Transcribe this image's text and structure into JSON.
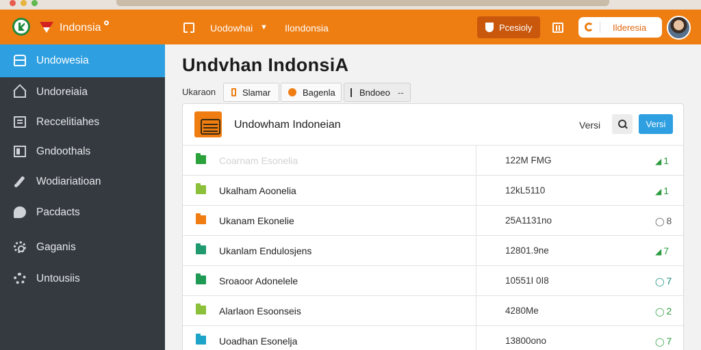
{
  "colors": {
    "header": "#ee7d12",
    "sidebar": "#353a41",
    "accent": "#2e9fe0",
    "count_green": "#2a9a3c",
    "count_teal": "#138a7a",
    "count_gray": "#555555"
  },
  "header": {
    "app_title": "Indonsia",
    "menu_label": "Uodowhai",
    "link_label": "Ilondonsia",
    "action_label": "Pcesioly",
    "search_value": "Ilderesia",
    "icons": {
      "logo": "logo-icon",
      "flag": "flag-icon",
      "book": "book-icon",
      "chevron": "chevron-down-icon",
      "shield": "shield-icon",
      "columns": "columns-icon",
      "search": "refresh-icon",
      "avatar": "avatar"
    }
  },
  "sidebar": {
    "items": [
      {
        "label": "Undowesia",
        "icon": "database-icon",
        "active": true
      },
      {
        "label": "Undoreiaia",
        "icon": "home-icon",
        "active": false
      },
      {
        "label": "Reccelitiahes",
        "icon": "document-icon",
        "active": false
      },
      {
        "label": "Gndoothals",
        "icon": "window-icon",
        "active": false
      },
      {
        "label": "Wodiariatioan",
        "icon": "pen-icon",
        "active": false
      },
      {
        "label": "Pacdacts",
        "icon": "chat-bubble-icon",
        "active": false
      },
      {
        "label": "Gaganis",
        "icon": "gear-icon",
        "active": false
      },
      {
        "label": "Untousiis",
        "icon": "settings-icon",
        "active": false
      }
    ]
  },
  "main": {
    "title": "Undvhan IndonsiA",
    "breadcrumb": "Ukaraon",
    "tabs": [
      {
        "label": "Slamar",
        "icon": "bookmark-icon"
      },
      {
        "label": "Bagenla",
        "icon": "shield-icon"
      },
      {
        "label": "Bndoeo",
        "icon": "tag-icon",
        "extra": "--"
      }
    ],
    "panel": {
      "title": "Undowham Indoneian",
      "version_label": "Versi",
      "button_label": "Versi",
      "rows": [
        {
          "name": "Coarnam Esonelia",
          "size": "122M FMG",
          "count": "1",
          "folder_color": "#2aa13a",
          "count_color": "#2a9a3c",
          "faded": true
        },
        {
          "name": "Ukalham Aoonelia",
          "size": "12kL5110",
          "count": "1",
          "folder_color": "#8cc03a",
          "count_color": "#2a9a3c",
          "faded": false
        },
        {
          "name": "Ukanam Ekonelie",
          "size": "25A1131no",
          "count": "8",
          "folder_color": "#ef7d12",
          "count_color": "#555555",
          "faded": false
        },
        {
          "name": "Ukanlam Endulosjens",
          "size": "12801.9ne",
          "count": "7",
          "folder_color": "#1f9a6e",
          "count_color": "#2a9a3c",
          "faded": false
        },
        {
          "name": "Sroaoor Adonelele",
          "size": "10551I 0I8",
          "count": "7",
          "folder_color": "#1f9a55",
          "count_color": "#138a7a",
          "faded": false
        },
        {
          "name": "Alarlaon Esoonseis",
          "size": "4280Me",
          "count": "2",
          "folder_color": "#8cc03a",
          "count_color": "#2a9a3c",
          "faded": false
        },
        {
          "name": "Uoadhan Esonelja",
          "size": "13800ono",
          "count": "7",
          "folder_color": "#1ea4c8",
          "count_color": "#2a9a3c",
          "faded": false
        }
      ]
    }
  }
}
